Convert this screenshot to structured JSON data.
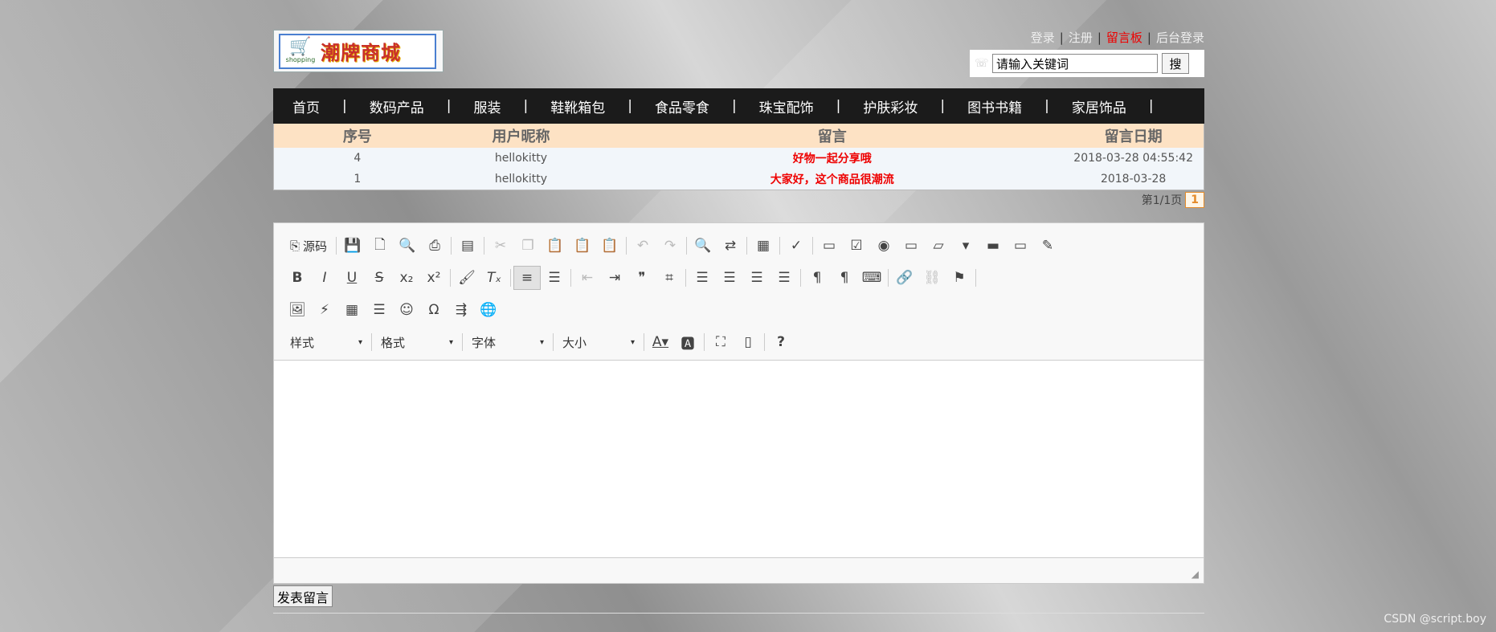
{
  "header": {
    "logo": {
      "cart_label": "shopping",
      "title": "潮牌商城"
    },
    "links": [
      {
        "label": "登录",
        "active": false
      },
      {
        "label": "注册",
        "active": false
      },
      {
        "label": "留言板",
        "active": true
      },
      {
        "label": "后台登录",
        "active": false
      }
    ],
    "search": {
      "value": "请输入关键词",
      "button": "搜"
    }
  },
  "nav": [
    "首页",
    "数码产品",
    "服装",
    "鞋靴箱包",
    "食品零食",
    "珠宝配饰",
    "护肤彩妆",
    "图书书籍",
    "家居饰品"
  ],
  "table": {
    "columns": [
      "序号",
      "用户昵称",
      "留言",
      "留言日期"
    ],
    "rows": [
      [
        "4",
        "hellokitty",
        "好物一起分享哦",
        "2018-03-28 04:55:42"
      ],
      [
        "1",
        "hellokitty",
        "大家好，这个商品很潮流",
        "2018-03-28"
      ]
    ]
  },
  "pager": {
    "info": "第1/1页",
    "current": "1"
  },
  "editor": {
    "source_label": "源码",
    "combos": [
      "样式",
      "格式",
      "字体",
      "大小"
    ],
    "content": ""
  },
  "submit_label": "发表留言",
  "watermark": "CSDN @script.boy",
  "colors": {
    "nav_bg": "#1b1b1b",
    "table_head_bg": "#fde2c4",
    "highlight": "#e00000",
    "pager": "#e58b2a"
  }
}
